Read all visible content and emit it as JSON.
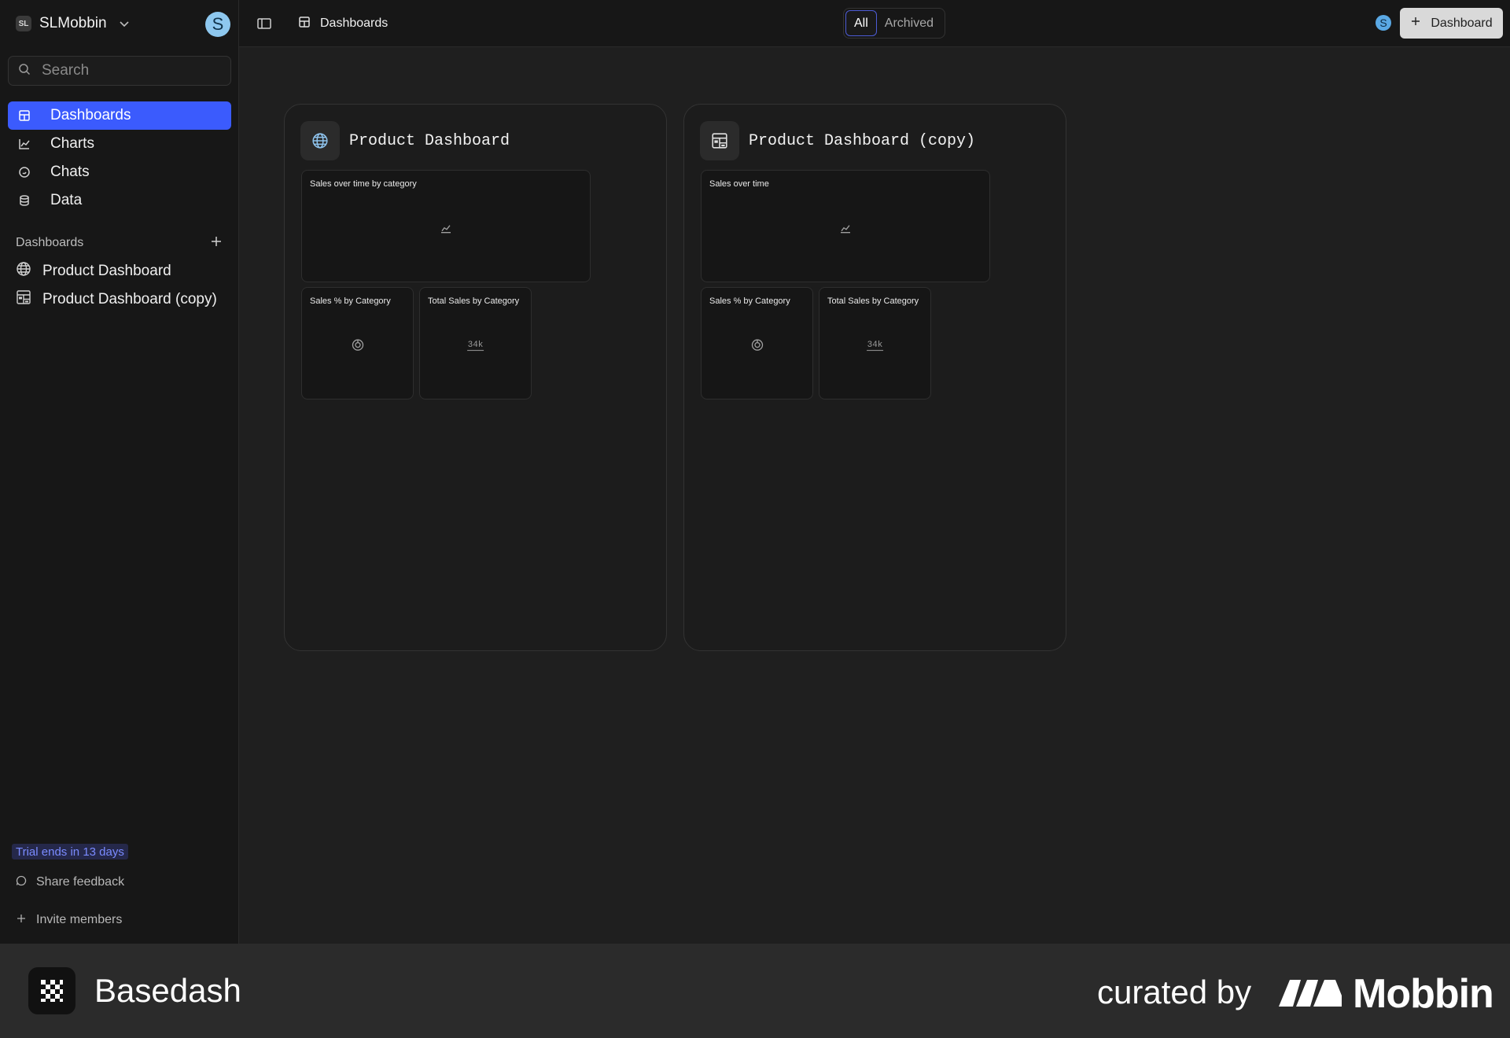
{
  "workspace": {
    "badge": "SL",
    "name": "SLMobbin",
    "avatar_letter": "S"
  },
  "search": {
    "placeholder": "Search"
  },
  "nav": {
    "items": [
      {
        "label": "Dashboards",
        "icon": "dashboard-icon",
        "active": true
      },
      {
        "label": "Charts",
        "icon": "line-chart-icon"
      },
      {
        "label": "Chats",
        "icon": "chat-icon"
      },
      {
        "label": "Data",
        "icon": "database-icon"
      }
    ]
  },
  "dashboards_section": {
    "title": "Dashboards",
    "items": [
      {
        "label": "Product Dashboard",
        "icon": "globe-icon"
      },
      {
        "label": "Product Dashboard (copy)",
        "icon": "grid-icon"
      }
    ]
  },
  "sidebar_footer": {
    "trial": "Trial ends in 13 days",
    "feedback": "Share feedback",
    "invite": "Invite members"
  },
  "topbar": {
    "breadcrumb": "Dashboards",
    "segments": [
      "All",
      "Archived"
    ],
    "selected_segment": "All",
    "avatar_letter": "S",
    "new_button": "Dashboard"
  },
  "cards": [
    {
      "title": "Product Dashboard",
      "icon": "globe-icon",
      "tiles": [
        {
          "title": "Sales over time by category",
          "icon": "line-chart-icon"
        },
        {
          "title": "Sales % by Category",
          "icon": "donut-chart-icon"
        },
        {
          "title": "Total Sales by Category",
          "icon": "number-icon",
          "value": "34k"
        }
      ]
    },
    {
      "title": "Product Dashboard (copy)",
      "icon": "grid-icon",
      "tiles": [
        {
          "title": "Sales over time",
          "icon": "line-chart-icon"
        },
        {
          "title": "Sales % by Category",
          "icon": "donut-chart-icon"
        },
        {
          "title": "Total Sales by Category",
          "icon": "number-icon",
          "value": "34k"
        }
      ]
    }
  ],
  "brand": {
    "app_name": "Basedash",
    "curated_by": "curated by",
    "curator": "Mobbin"
  },
  "colors": {
    "accent": "#3b5bfd",
    "background": "#1f1f1f",
    "sidebar": "#171717",
    "trial_text": "#7a8bff"
  }
}
